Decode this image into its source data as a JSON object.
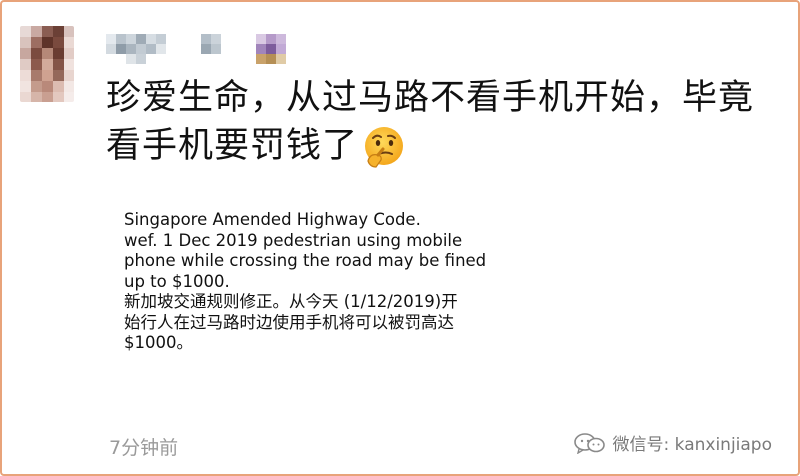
{
  "post": {
    "line1": "珍爱生命，从过马路不看手机开始，毕竟",
    "line2": "看手机要罚钱了"
  },
  "emoji_icon": "thinking-face-emoji",
  "notice": {
    "lines": [
      "Singapore Amended Highway Code.",
      "wef. 1 Dec 2019 pedestrian using mobile",
      "phone while crossing the road may be fined",
      "up to $1000.",
      "新加坡交通规则修正。从今天 (1/12/2019)开",
      "始行人在过马路时边使用手机将可以被罚高达",
      "$1000。"
    ]
  },
  "timestamp": "7分钟前",
  "watermark": {
    "icon": "wechat-icon",
    "text": "微信号: kanxinjiapo"
  },
  "colors": {
    "border": "#e8a37a",
    "text": "#111111",
    "timestamp": "#9a9a9a",
    "watermark": "#7a7a7a"
  }
}
